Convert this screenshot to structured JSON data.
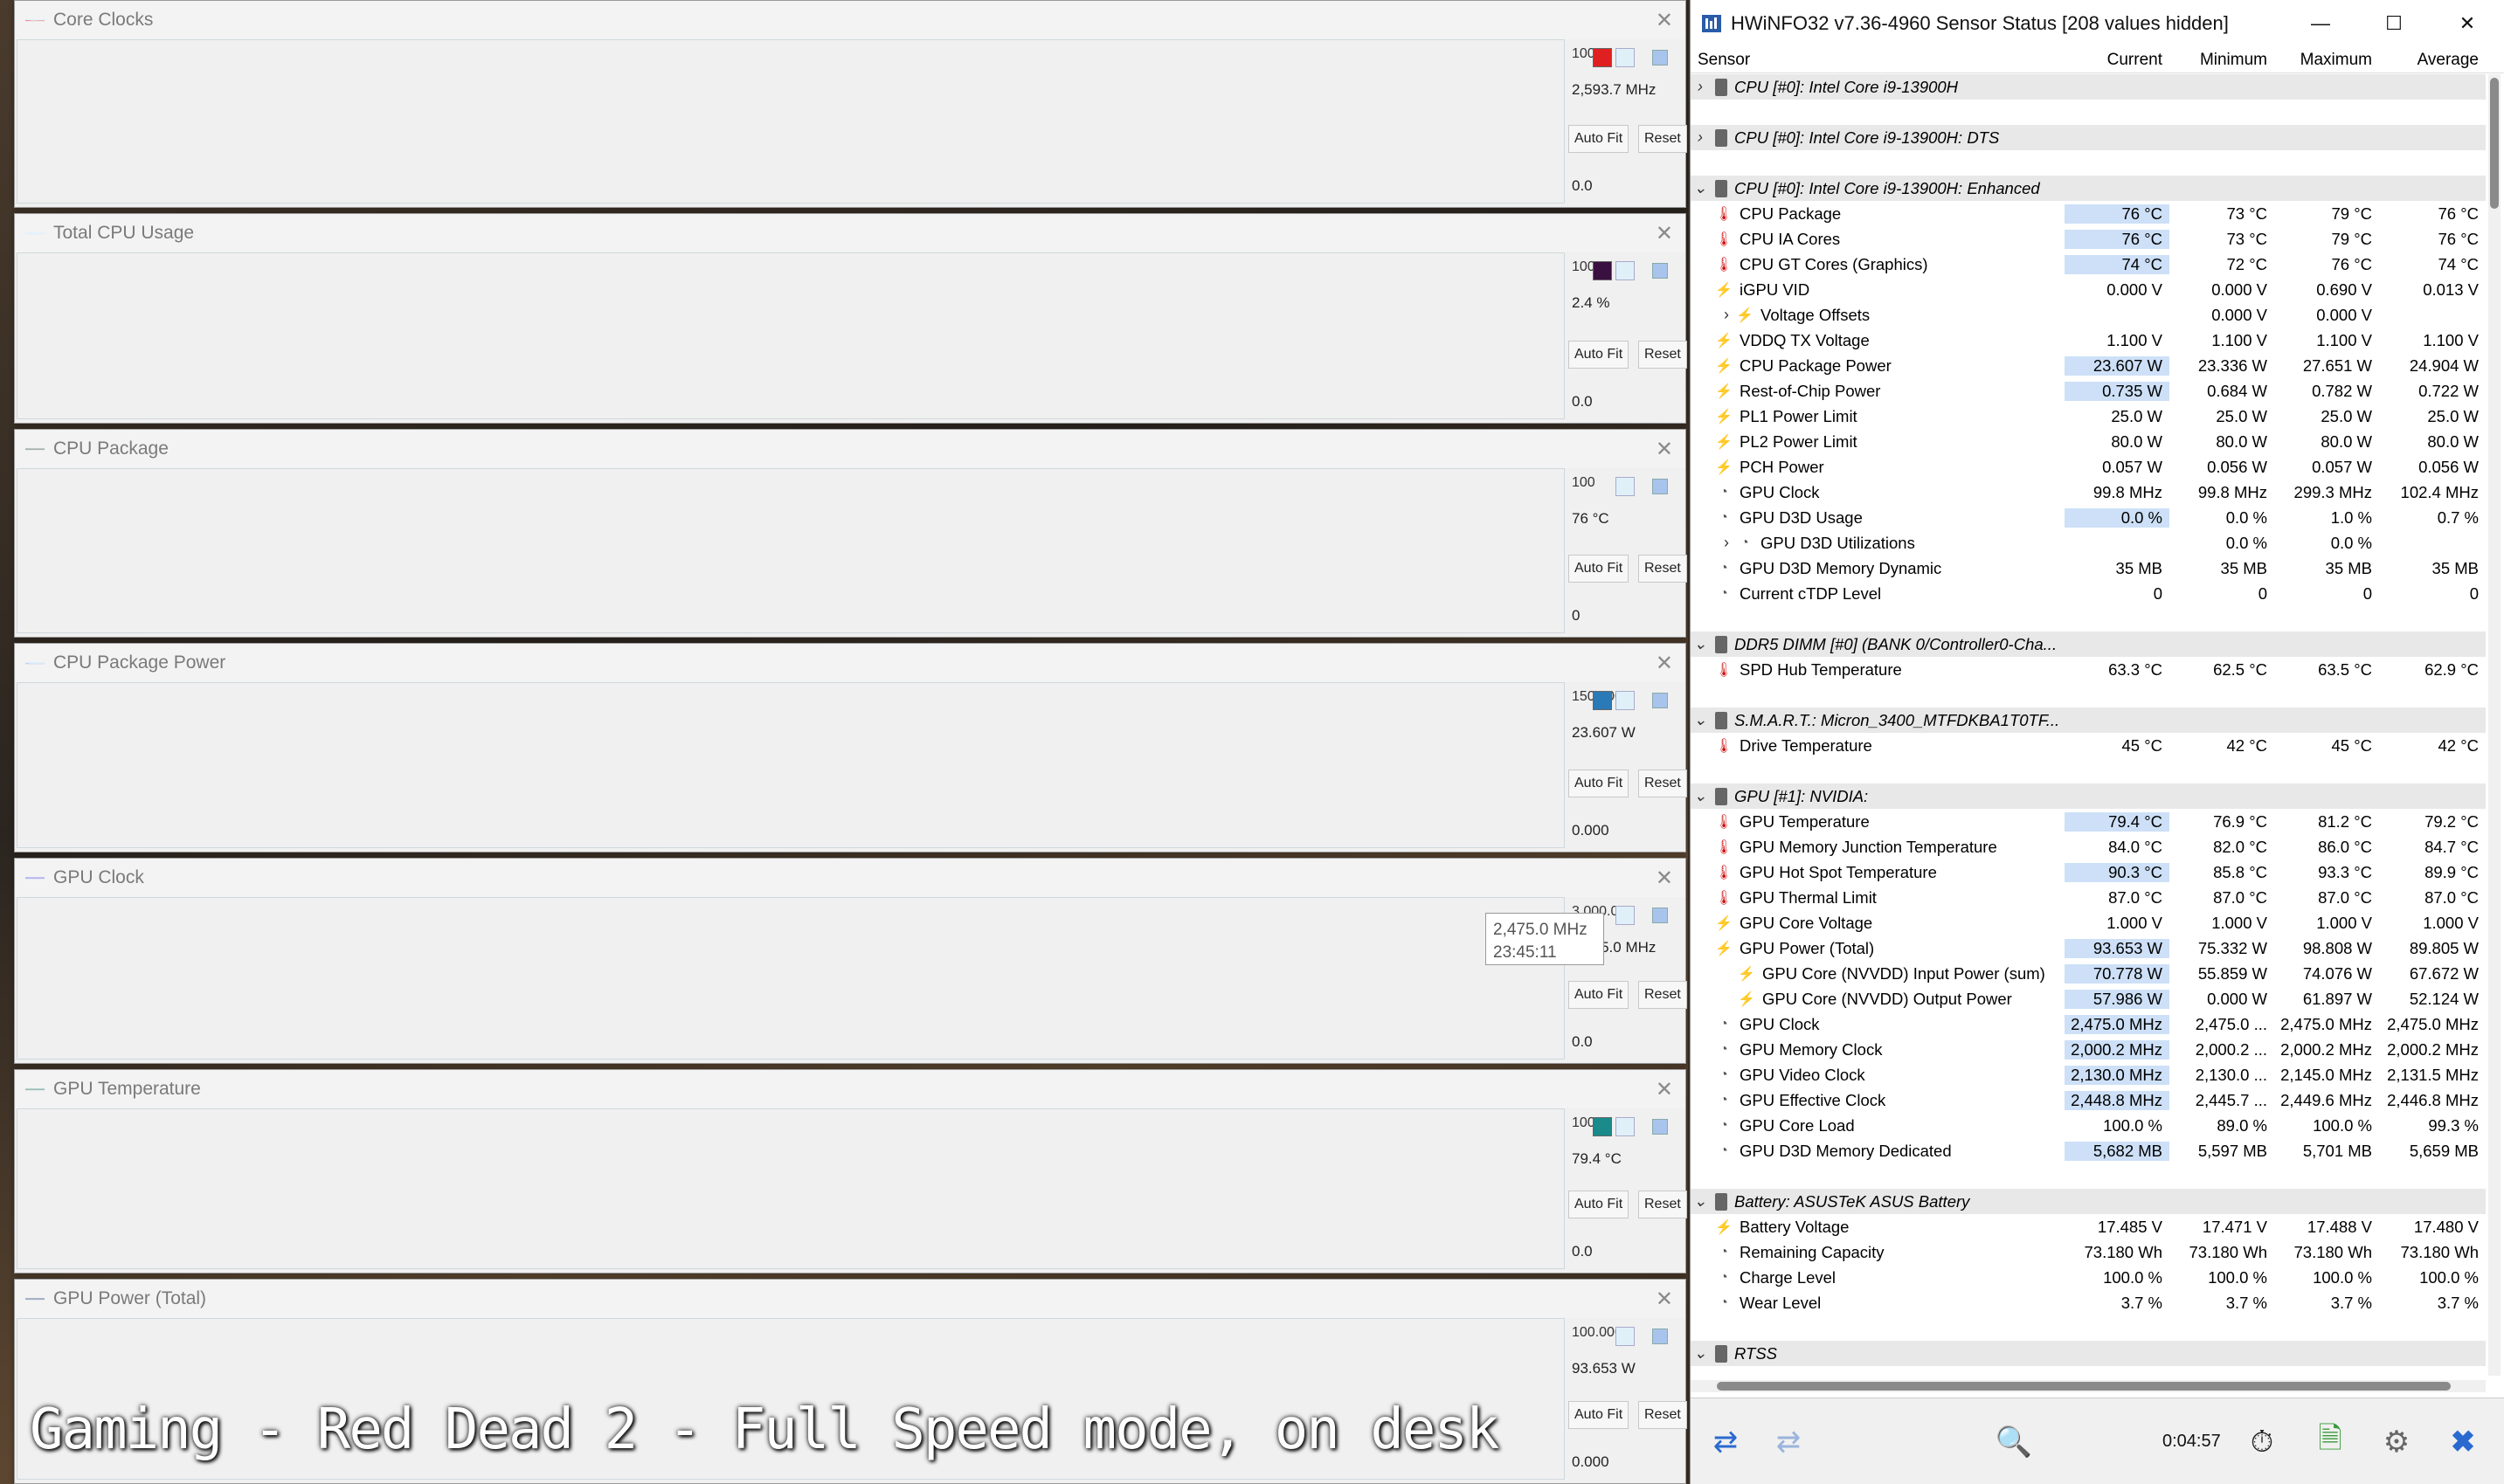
{
  "caption": "Gaming - Red Dead 2 - Full Speed mode, on desk",
  "tooltip": {
    "value": "2,475.0 MHz",
    "time": "23:45:11"
  },
  "graphs": [
    {
      "title": "Core Clocks",
      "max": "100",
      "current": "2,593.7 MHz",
      "min": "0.0",
      "color": "#f08a8a",
      "line": "#e02020",
      "swatch": "#e02020",
      "level": 0.22
    },
    {
      "title": "Total CPU Usage",
      "max": "100.0",
      "current": "2.4 %",
      "min": "0.0",
      "color": "#9a8aa0",
      "line": "#4a2050",
      "swatch": "#3a1040",
      "level": 0.03
    },
    {
      "title": "CPU Package",
      "max": "100",
      "current": "76 °C",
      "min": "0",
      "color": "#a8aeaa",
      "line": "#6e7a72",
      "swatch": "",
      "level": 0.74
    },
    {
      "title": "CPU Package Power",
      "max": "150.000",
      "current": "23.607 W",
      "min": "0.000",
      "color": "#90a6e4",
      "line": "#3a64c8",
      "swatch": "#2a7ab8",
      "level": 0.13
    },
    {
      "title": "GPU Clock",
      "max": "3,000.0",
      "current": "2,475.0 MHz",
      "min": "0.0",
      "color": "#b4b4ec",
      "line": "#8080c8",
      "swatch": "",
      "level": 0.82
    },
    {
      "title": "GPU Temperature",
      "max": "100.0",
      "current": "79.4 °C",
      "min": "0.0",
      "color": "#9cbcb4",
      "line": "#4a8a84",
      "swatch": "#1a8a8a",
      "level": 0.76
    },
    {
      "title": "GPU Power (Total)",
      "max": "100.000",
      "current": "93.653 W",
      "min": "0.000",
      "color": "#a4b0c4",
      "line": "#6a80a8",
      "swatch": "",
      "level": 0.92
    }
  ],
  "buttons": {
    "autofit": "Auto Fit",
    "reset": "Reset"
  },
  "hw": {
    "title": "HWiNFO32 v7.36-4960 Sensor Status [208 values hidden]",
    "columns": [
      "Sensor",
      "Current",
      "Minimum",
      "Maximum",
      "Average"
    ],
    "elapsed": "0:04:57",
    "rows": [
      {
        "type": "grp",
        "arrow": ">",
        "label": "CPU [#0]: Intel Core i9-13900H"
      },
      {
        "type": "blank"
      },
      {
        "type": "grp",
        "arrow": ">",
        "label": "CPU [#0]: Intel Core i9-13900H: DTS"
      },
      {
        "type": "blank"
      },
      {
        "type": "grp",
        "arrow": "v",
        "label": "CPU [#0]: Intel Core i9-13900H: Enhanced"
      },
      {
        "type": "s",
        "icon": "temp",
        "label": "CPU Package",
        "cur": "76 °C",
        "min": "73 °C",
        "max": "79 °C",
        "avg": "76 °C",
        "hl": true
      },
      {
        "type": "s",
        "icon": "temp",
        "label": "CPU IA Cores",
        "cur": "76 °C",
        "min": "73 °C",
        "max": "79 °C",
        "avg": "76 °C",
        "hl": true
      },
      {
        "type": "s",
        "icon": "temp",
        "label": "CPU GT Cores (Graphics)",
        "cur": "74 °C",
        "min": "72 °C",
        "max": "76 °C",
        "avg": "74 °C",
        "hl": true
      },
      {
        "type": "s",
        "icon": "volt",
        "label": "iGPU VID",
        "cur": "0.000 V",
        "min": "0.000 V",
        "max": "0.690 V",
        "avg": "0.013 V"
      },
      {
        "type": "s",
        "icon": "volt",
        "arrow": ">",
        "indent": 1,
        "label": "Voltage Offsets",
        "cur": "",
        "min": "0.000 V",
        "max": "0.000 V",
        "avg": ""
      },
      {
        "type": "s",
        "icon": "volt",
        "label": "VDDQ TX Voltage",
        "cur": "1.100 V",
        "min": "1.100 V",
        "max": "1.100 V",
        "avg": "1.100 V"
      },
      {
        "type": "s",
        "icon": "volt",
        "label": "CPU Package Power",
        "cur": "23.607 W",
        "min": "23.336 W",
        "max": "27.651 W",
        "avg": "24.904 W",
        "hl": true
      },
      {
        "type": "s",
        "icon": "volt",
        "label": "Rest-of-Chip Power",
        "cur": "0.735 W",
        "min": "0.684 W",
        "max": "0.782 W",
        "avg": "0.722 W",
        "hl": true
      },
      {
        "type": "s",
        "icon": "volt",
        "label": "PL1 Power Limit",
        "cur": "25.0 W",
        "min": "25.0 W",
        "max": "25.0 W",
        "avg": "25.0 W"
      },
      {
        "type": "s",
        "icon": "volt",
        "label": "PL2 Power Limit",
        "cur": "80.0 W",
        "min": "80.0 W",
        "max": "80.0 W",
        "avg": "80.0 W"
      },
      {
        "type": "s",
        "icon": "volt",
        "label": "PCH Power",
        "cur": "0.057 W",
        "min": "0.056 W",
        "max": "0.057 W",
        "avg": "0.056 W"
      },
      {
        "type": "s",
        "icon": "clock",
        "label": "GPU Clock",
        "cur": "99.8 MHz",
        "min": "99.8 MHz",
        "max": "299.3 MHz",
        "avg": "102.4 MHz"
      },
      {
        "type": "s",
        "icon": "clock",
        "label": "GPU D3D Usage",
        "cur": "0.0 %",
        "min": "0.0 %",
        "max": "1.0 %",
        "avg": "0.7 %",
        "hl": true
      },
      {
        "type": "s",
        "icon": "clock",
        "arrow": ">",
        "indent": 1,
        "label": "GPU D3D Utilizations",
        "cur": "",
        "min": "0.0 %",
        "max": "0.0 %",
        "avg": ""
      },
      {
        "type": "s",
        "icon": "clock",
        "label": "GPU D3D Memory Dynamic",
        "cur": "35 MB",
        "min": "35 MB",
        "max": "35 MB",
        "avg": "35 MB"
      },
      {
        "type": "s",
        "icon": "clock",
        "label": "Current cTDP Level",
        "cur": "0",
        "min": "0",
        "max": "0",
        "avg": "0"
      },
      {
        "type": "blank"
      },
      {
        "type": "grp",
        "arrow": "v",
        "label": "DDR5 DIMM [#0] (BANK 0/Controller0-Cha..."
      },
      {
        "type": "s",
        "icon": "temp",
        "label": "SPD Hub Temperature",
        "cur": "63.3 °C",
        "min": "62.5 °C",
        "max": "63.5 °C",
        "avg": "62.9 °C"
      },
      {
        "type": "blank"
      },
      {
        "type": "grp",
        "arrow": "v",
        "label": "S.M.A.R.T.: Micron_3400_MTFDKBA1T0TF..."
      },
      {
        "type": "s",
        "icon": "temp",
        "label": "Drive Temperature",
        "cur": "45 °C",
        "min": "42 °C",
        "max": "45 °C",
        "avg": "42 °C"
      },
      {
        "type": "blank"
      },
      {
        "type": "grp",
        "arrow": "v",
        "label": "GPU [#1]: NVIDIA:"
      },
      {
        "type": "s",
        "icon": "temp",
        "label": "GPU Temperature",
        "cur": "79.4 °C",
        "min": "76.9 °C",
        "max": "81.2 °C",
        "avg": "79.2 °C",
        "hl": true
      },
      {
        "type": "s",
        "icon": "temp",
        "label": "GPU Memory Junction Temperature",
        "cur": "84.0 °C",
        "min": "82.0 °C",
        "max": "86.0 °C",
        "avg": "84.7 °C"
      },
      {
        "type": "s",
        "icon": "temp",
        "label": "GPU Hot Spot Temperature",
        "cur": "90.3 °C",
        "min": "85.8 °C",
        "max": "93.3 °C",
        "avg": "89.9 °C",
        "hl": true
      },
      {
        "type": "s",
        "icon": "temp",
        "label": "GPU Thermal Limit",
        "cur": "87.0 °C",
        "min": "87.0 °C",
        "max": "87.0 °C",
        "avg": "87.0 °C"
      },
      {
        "type": "s",
        "icon": "volt",
        "label": "GPU Core Voltage",
        "cur": "1.000 V",
        "min": "1.000 V",
        "max": "1.000 V",
        "avg": "1.000 V"
      },
      {
        "type": "s",
        "icon": "volt",
        "label": "GPU Power (Total)",
        "cur": "93.653 W",
        "min": "75.332 W",
        "max": "98.808 W",
        "avg": "89.805 W",
        "hl": true
      },
      {
        "type": "s",
        "icon": "volt",
        "indent": 1,
        "label": "GPU Core (NVVDD) Input Power (sum)",
        "cur": "70.778 W",
        "min": "55.859 W",
        "max": "74.076 W",
        "avg": "67.672 W",
        "hl": true
      },
      {
        "type": "s",
        "icon": "volt",
        "indent": 1,
        "label": "GPU Core (NVVDD) Output Power",
        "cur": "57.986 W",
        "min": "0.000 W",
        "max": "61.897 W",
        "avg": "52.124 W",
        "hl": true
      },
      {
        "type": "s",
        "icon": "clock",
        "label": "GPU Clock",
        "cur": "2,475.0 MHz",
        "min": "2,475.0 ...",
        "max": "2,475.0 MHz",
        "avg": "2,475.0 MHz",
        "hl": true
      },
      {
        "type": "s",
        "icon": "clock",
        "label": "GPU Memory Clock",
        "cur": "2,000.2 MHz",
        "min": "2,000.2 ...",
        "max": "2,000.2 MHz",
        "avg": "2,000.2 MHz",
        "hl": true
      },
      {
        "type": "s",
        "icon": "clock",
        "label": "GPU Video Clock",
        "cur": "2,130.0 MHz",
        "min": "2,130.0 ...",
        "max": "2,145.0 MHz",
        "avg": "2,131.5 MHz",
        "hl": true
      },
      {
        "type": "s",
        "icon": "clock",
        "label": "GPU Effective Clock",
        "cur": "2,448.8 MHz",
        "min": "2,445.7 ...",
        "max": "2,449.6 MHz",
        "avg": "2,446.8 MHz",
        "hl": true
      },
      {
        "type": "s",
        "icon": "clock",
        "label": "GPU Core Load",
        "cur": "100.0 %",
        "min": "89.0 %",
        "max": "100.0 %",
        "avg": "99.3 %"
      },
      {
        "type": "s",
        "icon": "clock",
        "label": "GPU D3D Memory Dedicated",
        "cur": "5,682 MB",
        "min": "5,597 MB",
        "max": "5,701 MB",
        "avg": "5,659 MB",
        "hl": true
      },
      {
        "type": "blank"
      },
      {
        "type": "grp",
        "arrow": "v",
        "label": "Battery: ASUSTeK ASUS Battery"
      },
      {
        "type": "s",
        "icon": "volt",
        "label": "Battery Voltage",
        "cur": "17.485 V",
        "min": "17.471 V",
        "max": "17.488 V",
        "avg": "17.480 V"
      },
      {
        "type": "s",
        "icon": "clock",
        "label": "Remaining Capacity",
        "cur": "73.180 Wh",
        "min": "73.180 Wh",
        "max": "73.180 Wh",
        "avg": "73.180 Wh"
      },
      {
        "type": "s",
        "icon": "clock",
        "label": "Charge Level",
        "cur": "100.0 %",
        "min": "100.0 %",
        "max": "100.0 %",
        "avg": "100.0 %"
      },
      {
        "type": "s",
        "icon": "clock",
        "label": "Wear Level",
        "cur": "3.7 %",
        "min": "3.7 %",
        "max": "3.7 %",
        "avg": "3.7 %"
      },
      {
        "type": "blank"
      },
      {
        "type": "grp",
        "arrow": "v",
        "label": "RTSS"
      }
    ]
  }
}
